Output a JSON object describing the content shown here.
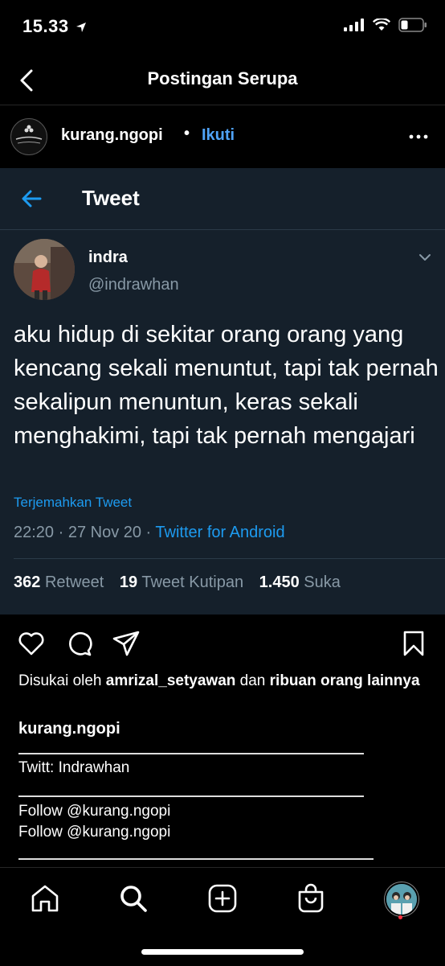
{
  "status_bar": {
    "time": "15.33"
  },
  "nav": {
    "title": "Postingan Serupa"
  },
  "post": {
    "username": "kurang.ngopi",
    "separator": "•",
    "follow_label": "Ikuti",
    "avatar_text": "@kurang.ngopi"
  },
  "tweet": {
    "header_title": "Tweet",
    "author_name": "indra",
    "author_handle": "@indrawhan",
    "text": "aku hidup di sekitar orang orang yang kencang sekali menuntut, tapi tak pernah sekalipun menuntun, keras sekali menghakimi, tapi tak pernah mengajari",
    "translate_label": "Terjemahkan Tweet",
    "timestamp": "22:20 · 27 Nov 20 · ",
    "source": "Twitter for Android",
    "stats": {
      "retweets": "362",
      "retweets_label": "Retweet",
      "quotes": "19",
      "quotes_label": "Tweet Kutipan",
      "likes": "1.450",
      "likes_label": "Suka"
    }
  },
  "caption": {
    "liked_prefix": "Disukai oleh ",
    "liked_user": "amrizal_setyawan",
    "liked_mid": " dan ",
    "liked_suffix": "ribuan orang lainnya",
    "owner": "kurang.ngopi",
    "line1": "Twitt: Indrawhan",
    "line2": "Follow @kurang.ngopi",
    "line3": "Follow @kurang.ngopi"
  },
  "icons": {
    "like": "heart-icon",
    "comment": "comment-icon",
    "share": "send-icon",
    "save": "bookmark-icon",
    "home": "home-icon",
    "search": "search-icon",
    "create": "plus-square-icon",
    "shop": "shopping-bag-icon"
  },
  "colors": {
    "background": "#000000",
    "tweet_bg": "#15202b",
    "link_blue": "#1d9bf0",
    "follow_blue": "#4fa3f7",
    "muted": "#8899a6"
  }
}
